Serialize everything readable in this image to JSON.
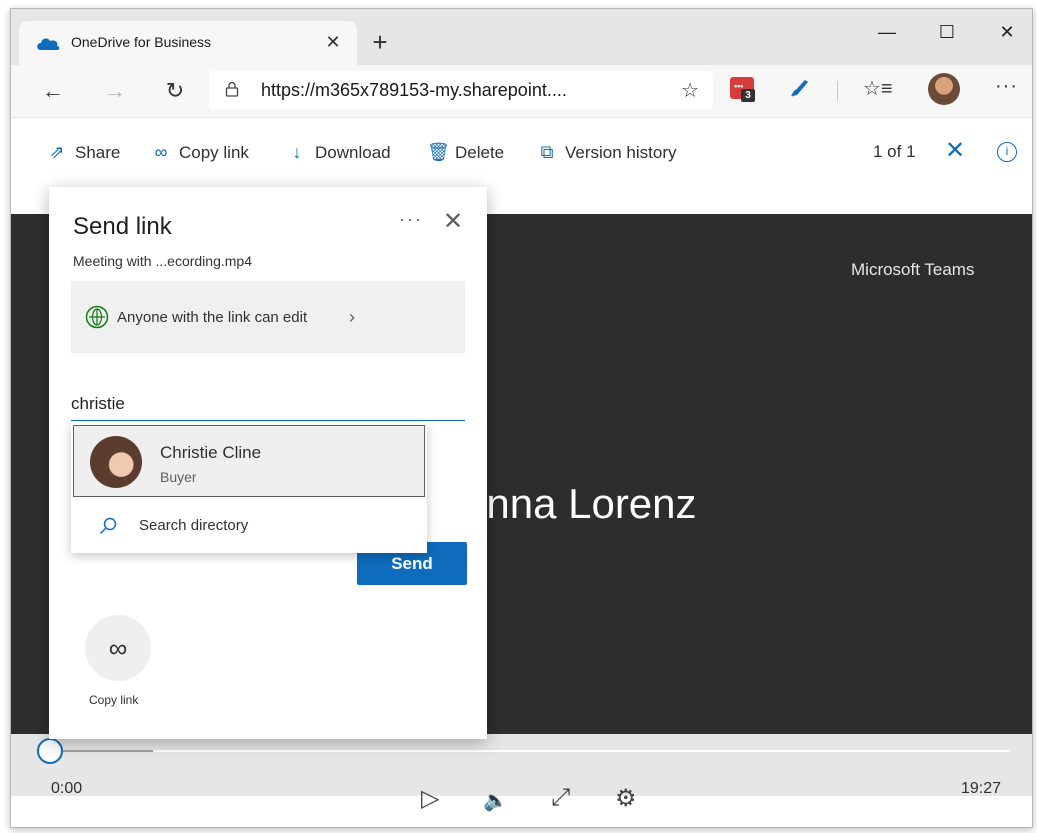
{
  "browser": {
    "tab_title": "OneDrive for Business",
    "tab_close": "✕",
    "new_tab": "+",
    "url": "https://m365x789153-my.sharepoint....",
    "extension_badge": "3",
    "window_controls": {
      "minimize": "—",
      "maximize": "☐",
      "close": "✕"
    },
    "more_label": "···"
  },
  "toolbar": {
    "share_label": "Share",
    "copy_link_label": "Copy link",
    "download_label": "Download",
    "delete_label": "Delete",
    "version_history_label": "Version history",
    "pager": "1 of 1"
  },
  "video": {
    "watermark": "Microsoft Teams",
    "presenter_name": "anna Lorenz",
    "current_time": "0:00",
    "duration": "19:27"
  },
  "send_link": {
    "title": "Send link",
    "file_name": "Meeting with ...ecording.mp4",
    "permission_text": "Anyone with the link can edit",
    "recipient_value": "christie",
    "send_label": "Send",
    "copy_link_label": "Copy link"
  },
  "suggestions": {
    "person": {
      "name": "Christie Cline",
      "role": "Buyer"
    },
    "search_directory_label": "Search directory"
  },
  "colors": {
    "accent": "#0f6cbd",
    "video_bg": "#2d2d2d",
    "globe_green": "#107c10"
  }
}
